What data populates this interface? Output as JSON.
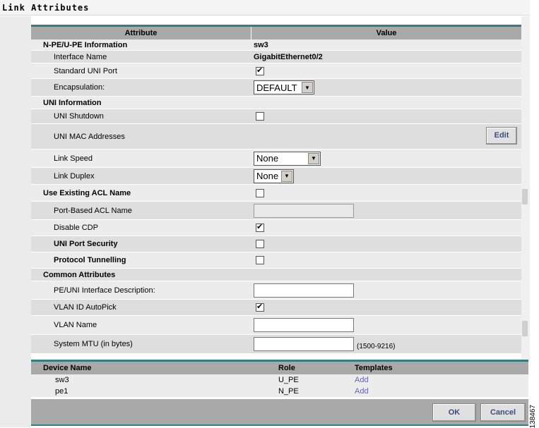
{
  "window": {
    "title": "Link Attributes"
  },
  "table": {
    "header_attribute": "Attribute",
    "header_value": "Value",
    "npe_section": {
      "label": "N-PE/U-PE Information",
      "value": "sw3"
    },
    "interface_name": {
      "label": "Interface Name",
      "value": "GigabitEthernet0/2"
    },
    "standard_uni_port": {
      "label": "Standard UNI Port",
      "checked": true
    },
    "encapsulation": {
      "label": "Encapsulation:",
      "value": "DEFAULT"
    },
    "uni_section": {
      "label": "UNI Information"
    },
    "uni_shutdown": {
      "label": "UNI Shutdown",
      "checked": false
    },
    "uni_mac": {
      "label": "UNI MAC Addresses",
      "button": "Edit"
    },
    "link_speed": {
      "label": "Link Speed",
      "value": "None"
    },
    "link_duplex": {
      "label": "Link Duplex",
      "value": "None"
    },
    "use_existing_acl": {
      "label": "Use Existing ACL Name",
      "checked": false
    },
    "port_based_acl": {
      "label": "Port-Based ACL Name",
      "value": ""
    },
    "disable_cdp": {
      "label": "Disable CDP",
      "checked": true
    },
    "uni_port_security": {
      "label": "UNI Port Security",
      "checked": false
    },
    "protocol_tunnelling": {
      "label": "Protocol Tunnelling",
      "checked": false
    },
    "common_section": {
      "label": "Common Attributes"
    },
    "pe_uni_desc": {
      "label": "PE/UNI Interface Description:",
      "value": ""
    },
    "vlan_autopick": {
      "label": "VLAN ID AutoPick",
      "checked": true
    },
    "vlan_name": {
      "label": "VLAN Name",
      "value": ""
    },
    "system_mtu": {
      "label": "System MTU (in bytes)",
      "value": "",
      "hint": "(1500-9216)"
    }
  },
  "devices": {
    "headers": {
      "name": "Device Name",
      "role": "Role",
      "templates": "Templates"
    },
    "rows": [
      {
        "name": "sw3",
        "role": "U_PE",
        "templates": "Add"
      },
      {
        "name": "pe1",
        "role": "N_PE",
        "templates": "Add"
      }
    ]
  },
  "footer": {
    "ok": "OK",
    "cancel": "Cancel"
  },
  "figure_id": "138467"
}
